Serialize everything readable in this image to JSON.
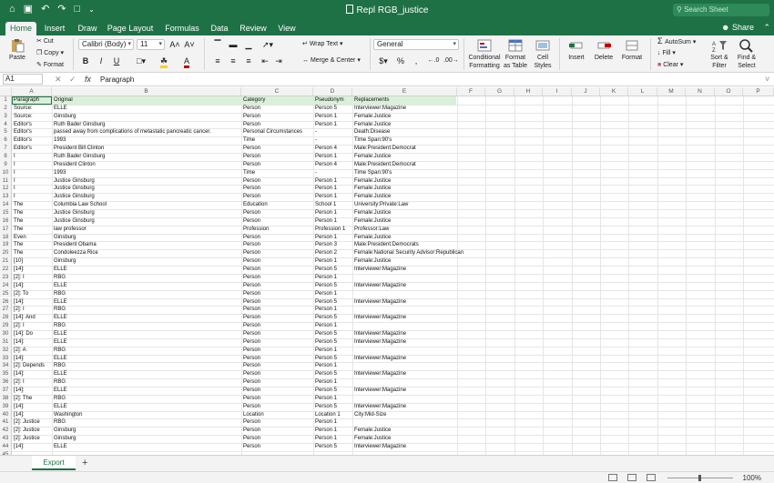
{
  "app": {
    "doc_title": "Repl RGB_justice",
    "search_placeholder": "Search Sheet",
    "share_label": "Share"
  },
  "tabs": [
    "Home",
    "Insert",
    "Draw",
    "Page Layout",
    "Formulas",
    "Data",
    "Review",
    "View"
  ],
  "ribbon": {
    "paste": "Paste",
    "cut": "Cut",
    "copy": "Copy",
    "format_painter": "Format",
    "font_name": "Calibri (Body)",
    "font_size": "11",
    "wrap_text": "Wrap Text",
    "merge_center": "Merge & Center",
    "number_format": "General",
    "conditional_formatting": [
      "Conditional",
      "Formatting"
    ],
    "format_as_table": [
      "Format",
      "as Table"
    ],
    "cell_styles": [
      "Cell",
      "Styles"
    ],
    "insert": "Insert",
    "delete": "Delete",
    "format": "Format",
    "autosum": "AutoSum",
    "fill": "Fill",
    "clear": "Clear",
    "sort_filter": [
      "Sort &",
      "Filter"
    ],
    "find_select": [
      "Find &",
      "Select"
    ],
    "bold": "B",
    "italic": "I",
    "underline": "U",
    "percent": "%",
    "comma": ","
  },
  "formula_bar": {
    "name_box": "A1",
    "fx": "fx",
    "content": "Paragraph"
  },
  "columns": [
    "A",
    "B",
    "C",
    "D",
    "E",
    "F",
    "G",
    "H",
    "I",
    "J",
    "K",
    "L",
    "M",
    "N",
    "O",
    "P"
  ],
  "rows": [
    [
      "Paragraph",
      "Original",
      "Category",
      "Pseudonym",
      "Replacements"
    ],
    [
      "Source:",
      "ELLE",
      "Person",
      "Person 5",
      "Interviewer:Magazine"
    ],
    [
      "Source:",
      "Ginsburg",
      "Person",
      "Person 1",
      "Female:Justice"
    ],
    [
      "Editor's",
      "Ruth Bader Ginsburg",
      "Person",
      "Person 1",
      "Female:Justice"
    ],
    [
      "Editor's",
      "passed away from complications of metastatic pancreatic cancer.",
      "Personal Circumstances",
      "-",
      "Death:Disease"
    ],
    [
      "Editor's",
      "1993",
      "Time",
      "-",
      "Time Span:90's"
    ],
    [
      "Editor's",
      "President Bill Clinton",
      "Person",
      "Person 4",
      "Male:President:Democrat"
    ],
    [
      "I",
      "Ruth Bader Ginsburg",
      "Person",
      "Person 1",
      "Female:Justice"
    ],
    [
      "I",
      "President Clinton",
      "Person",
      "Person 4",
      "Male:President:Democrat"
    ],
    [
      "I",
      "1993",
      "Time",
      "-",
      "Time Span:90's"
    ],
    [
      "I",
      "Justice Ginsburg",
      "Person",
      "Person 1",
      "Female:Justice"
    ],
    [
      "I",
      "Justice Ginsburg",
      "Person",
      "Person 1",
      "Female:Justice"
    ],
    [
      "I",
      "Justice Ginsburg",
      "Person",
      "Person 1",
      "Female:Justice"
    ],
    [
      "The",
      "Columbia Law School",
      "Education",
      "School 1",
      "University:Private:Law"
    ],
    [
      "The",
      "Justice Ginsburg",
      "Person",
      "Person 1",
      "Female:Justice"
    ],
    [
      "The",
      "Justice Ginsburg",
      "Person",
      "Person 1",
      "Female:Justice"
    ],
    [
      "The",
      "law professor",
      "Profession",
      "Profession 1",
      "Professor:Law"
    ],
    [
      "Even",
      "Ginsburg",
      "Person",
      "Person 1",
      "Female:Justice"
    ],
    [
      "The",
      "President Obama",
      "Person",
      "Person 3",
      "Male:President:Democrats"
    ],
    [
      "The",
      "Condoleezza Rice",
      "Person",
      "Person 2",
      "Female:National Security Advisor:Republican"
    ],
    [
      "[10]",
      "Ginsburg",
      "Person",
      "Person 1",
      "Female:Justice"
    ],
    [
      "[14]:",
      "ELLE",
      "Person",
      "Person 5",
      "Interviewer:Magazine"
    ],
    [
      "[2]: I",
      "RBG",
      "Person",
      "Person 1",
      ""
    ],
    [
      "[14]:",
      "ELLE",
      "Person",
      "Person 5",
      "Interviewer:Magazine"
    ],
    [
      "[2]: To",
      "RBG",
      "Person",
      "Person 1",
      ""
    ],
    [
      "[14]:",
      "ELLE",
      "Person",
      "Person 5",
      "Interviewer:Magazine"
    ],
    [
      "[2]: I",
      "RBG",
      "Person",
      "Person 1",
      ""
    ],
    [
      "[14]: And",
      "ELLE",
      "Person",
      "Person 5",
      "Interviewer:Magazine"
    ],
    [
      "[2]: I",
      "RBG",
      "Person",
      "Person 1",
      ""
    ],
    [
      "[14]: Do",
      "ELLE",
      "Person",
      "Person 5",
      "Interviewer:Magazine"
    ],
    [
      "[14]:",
      "ELLE",
      "Person",
      "Person 5",
      "Interviewer:Magazine"
    ],
    [
      "[2]: A",
      "RBG",
      "Person",
      "Person 1",
      ""
    ],
    [
      "[14]:",
      "ELLE",
      "Person",
      "Person 5",
      "Interviewer:Magazine"
    ],
    [
      "[2]: Depends",
      "RBG",
      "Person",
      "Person 1",
      ""
    ],
    [
      "[14]:",
      "ELLE",
      "Person",
      "Person 5",
      "Interviewer:Magazine"
    ],
    [
      "[2]: I",
      "RBG",
      "Person",
      "Person 1",
      ""
    ],
    [
      "[14]:",
      "ELLE",
      "Person",
      "Person 5",
      "Interviewer:Magazine"
    ],
    [
      "[2]: The",
      "RBG",
      "Person",
      "Person 1",
      ""
    ],
    [
      "[14]:",
      "ELLE",
      "Person",
      "Person 5",
      "Interviewer:Magazine"
    ],
    [
      "[14]:",
      "Washington",
      "Location",
      "Location 1",
      "City:Mid-Size"
    ],
    [
      "[2]: Justice",
      "RBG",
      "Person",
      "Person 1",
      ""
    ],
    [
      "[2]: Justice",
      "Ginsburg",
      "Person",
      "Person 1",
      "Female:Justice"
    ],
    [
      "[2]: Justice",
      "Ginsburg",
      "Person",
      "Person 1",
      "Female:Justice"
    ],
    [
      "[14]:",
      "ELLE",
      "Person",
      "Person 5",
      "Interviewer:Magazine"
    ]
  ],
  "sheet_tab": "Export",
  "add_sheet": "+",
  "zoom_level": "100%",
  "colors": {
    "accent": "#1e7145",
    "header_fill": "#d9f0d9",
    "font_color": "#c00000",
    "highlight": "#ffd200"
  }
}
